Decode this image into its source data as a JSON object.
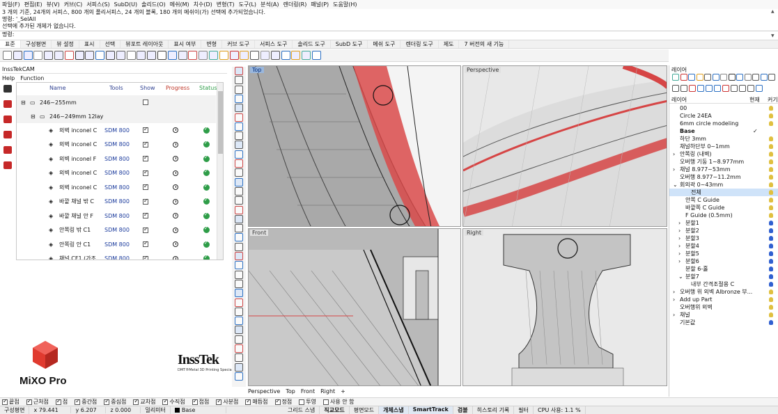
{
  "menu": [
    "파일(F)",
    "편집(E)",
    "뷰(V)",
    "커브(C)",
    "서피스(S)",
    "SubD(U)",
    "솔리드(O)",
    "메쉬(M)",
    "치수(D)",
    "변형(T)",
    "도구(L)",
    "분석(A)",
    "렌더링(R)",
    "패널(P)",
    "도움말(H)"
  ],
  "command_history": {
    "line1": "3 개의 기준, 24개의 서피스, 800 개의 폴리서피스, 24 개의 블록, 180 개의 메쉬이(가) 선택에 추가되었습니다.",
    "line2": "명령: '_SelAll",
    "line3": "선택에 추가된 개체가 없습니다."
  },
  "command_prompt": "명령:",
  "tabs": [
    "표준",
    "구성평면",
    "뷰 설정",
    "표시",
    "선택",
    "뷰포트 레이아웃",
    "표시 여부",
    "변형",
    "커브 도구",
    "서피스 도구",
    "솔리드 도구",
    "SubD 도구",
    "메쉬 도구",
    "렌더링 도구",
    "제도",
    "7 버전의 새 기능"
  ],
  "active_tab": "표준",
  "left_panel": {
    "title": "InssTekCAM",
    "menu_help": "Help",
    "menu_function": "Function",
    "columns": {
      "name": "Name",
      "tools": "Tools",
      "show": "Show",
      "progress": "Progress",
      "status": "Status"
    },
    "groups": [
      {
        "label": "246~255mm",
        "checked": false
      },
      {
        "label": "246~249mm 12lay",
        "checked": false
      }
    ],
    "rows": [
      {
        "name": "외벽 inconel C",
        "tool": "SDM 800"
      },
      {
        "name": "외벽 inconel C",
        "tool": "SDM 800"
      },
      {
        "name": "외벽 inconel F",
        "tool": "SDM 800"
      },
      {
        "name": "외벽 inconel C",
        "tool": "SDM 800"
      },
      {
        "name": "외벽 inconel C",
        "tool": "SDM 800"
      },
      {
        "name": "바깥 채널 밖 C",
        "tool": "SDM 800"
      },
      {
        "name": "바깥 채널 안 F",
        "tool": "SDM 800"
      },
      {
        "name": "안쪽링 밖 C1",
        "tool": "SDM 800"
      },
      {
        "name": "안쪽링 안 C1",
        "tool": "SDM 800"
      },
      {
        "name": "채널 CF1 (가조",
        "tool": "SDM 800"
      }
    ],
    "brand_left": "MiXO Pro",
    "brand_right": "InssTek",
    "brand_right_tag": "DMT®Metal 3D Printing Specialist"
  },
  "viewports": {
    "top": "Top",
    "perspective": "Perspective",
    "front": "Front",
    "right": "Right"
  },
  "viewport_tabs": [
    "Perspective",
    "Top",
    "Front",
    "Right"
  ],
  "layers": {
    "title": "레이어",
    "col_name": "레이어",
    "col_current": "현재",
    "col_lock": "커기",
    "items": [
      {
        "name": "00",
        "indent": 0,
        "arrow": "",
        "current": "",
        "bulb": "#e0c040"
      },
      {
        "name": "Circle 24EA",
        "indent": 0,
        "arrow": "",
        "current": "",
        "bulb": "#e0c040"
      },
      {
        "name": "6mm circle modeling",
        "indent": 0,
        "arrow": "",
        "current": "",
        "bulb": "#e0c040"
      },
      {
        "name": "Base",
        "indent": 0,
        "arrow": "",
        "current": "✓",
        "bulb": "",
        "bold": true
      },
      {
        "name": "하단 3mm",
        "indent": 0,
        "arrow": "",
        "current": "",
        "bulb": "#e0c040"
      },
      {
        "name": "채널하단부 0~1mm",
        "indent": 0,
        "arrow": "",
        "current": "",
        "bulb": "#e0c040"
      },
      {
        "name": "안쪽링 (내벽)",
        "indent": 0,
        "arrow": ">",
        "current": "",
        "bulb": "#e0c040"
      },
      {
        "name": "오버행 기둥 1~8.977mm",
        "indent": 0,
        "arrow": "",
        "current": "",
        "bulb": "#e0c040"
      },
      {
        "name": "채널 8.977~53mm",
        "indent": 0,
        "arrow": ">",
        "current": "",
        "bulb": "#e0c040"
      },
      {
        "name": "오버행 8.977~11.2mm",
        "indent": 0,
        "arrow": "",
        "current": "",
        "bulb": "#e0c040"
      },
      {
        "name": "회외곽 0~43mm",
        "indent": 0,
        "arrow": "v",
        "current": "",
        "bulb": "#e0c040"
      },
      {
        "name": "전체",
        "indent": 2,
        "arrow": "",
        "current": "",
        "bulb": "#e0c040",
        "selected": true
      },
      {
        "name": "안쪽 C Guide",
        "indent": 1,
        "arrow": "",
        "current": "",
        "bulb": "#e0c040"
      },
      {
        "name": "바깥쪽 C Guide",
        "indent": 1,
        "arrow": "",
        "current": "",
        "bulb": "#e0c040"
      },
      {
        "name": "F Guide (0.5mm)",
        "indent": 1,
        "arrow": "",
        "current": "",
        "bulb": "#e0c040"
      },
      {
        "name": "분할1",
        "indent": 1,
        "arrow": ">",
        "current": "",
        "bulb": "#3060d0"
      },
      {
        "name": "분할2",
        "indent": 1,
        "arrow": ">",
        "current": "",
        "bulb": "#3060d0"
      },
      {
        "name": "분할3",
        "indent": 1,
        "arrow": ">",
        "current": "",
        "bulb": "#3060d0"
      },
      {
        "name": "분할4",
        "indent": 1,
        "arrow": ">",
        "current": "",
        "bulb": "#3060d0"
      },
      {
        "name": "분할5",
        "indent": 1,
        "arrow": ">",
        "current": "",
        "bulb": "#3060d0"
      },
      {
        "name": "분할6",
        "indent": 1,
        "arrow": ">",
        "current": "",
        "bulb": "#3060d0"
      },
      {
        "name": "분할 6-홀",
        "indent": 1,
        "arrow": "",
        "current": "",
        "bulb": "#3060d0"
      },
      {
        "name": "분할7",
        "indent": 1,
        "arrow": "v",
        "current": "",
        "bulb": "#3060d0"
      },
      {
        "name": "내부 간격조절용 C",
        "indent": 2,
        "arrow": "",
        "current": "",
        "bulb": "#3060d0"
      },
      {
        "name": "오버행 위 외벽 Albronze 부...",
        "indent": 0,
        "arrow": ">",
        "current": "",
        "bulb": "#e0c040"
      },
      {
        "name": "Add up Part",
        "indent": 0,
        "arrow": ">",
        "current": "",
        "bulb": "#e0c040"
      },
      {
        "name": "오버행위 외벽",
        "indent": 0,
        "arrow": "",
        "current": "",
        "bulb": "#e0c040"
      },
      {
        "name": "채널",
        "indent": 0,
        "arrow": ">",
        "current": "",
        "bulb": "#e0c040"
      },
      {
        "name": "기본값",
        "indent": 0,
        "arrow": "",
        "current": "",
        "bulb": "#3060d0"
      }
    ]
  },
  "osnap": [
    {
      "label": "끝점",
      "on": true
    },
    {
      "label": "근처점",
      "on": true
    },
    {
      "label": "점",
      "on": true
    },
    {
      "label": "중간점",
      "on": true
    },
    {
      "label": "중심점",
      "on": true
    },
    {
      "label": "교차점",
      "on": true
    },
    {
      "label": "수직점",
      "on": true
    },
    {
      "label": "접점",
      "on": true
    },
    {
      "label": "사분점",
      "on": true
    },
    {
      "label": "매듭점",
      "on": true
    },
    {
      "label": "정점",
      "on": true
    },
    {
      "label": "투영",
      "on": false
    },
    {
      "label": "사용 안 함",
      "on": false
    }
  ],
  "status": {
    "cplane": "구성평면",
    "x": "x 79.441",
    "y": "y 6.207",
    "z": "z 0.000",
    "units": "밀리미터",
    "layer": "Base",
    "toggles": [
      "그리드 스냅",
      "직교모드",
      "평면모드",
      "개체스냅",
      "SmartTrack",
      "검볼",
      "히스토리 기록",
      "필터"
    ],
    "cpu": "CPU 사용: 1.1 %"
  },
  "colors": {
    "accent": "#d93a3a",
    "selection": "#cfe3f9",
    "status_ok": "#2e9d48",
    "mesh_red": "#d64545"
  }
}
